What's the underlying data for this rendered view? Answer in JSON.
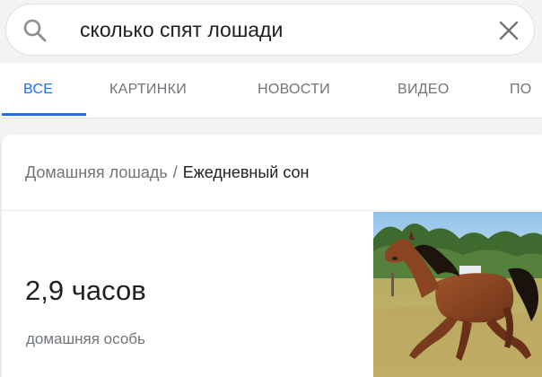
{
  "search": {
    "query": "сколько спят лошади",
    "search_icon": "search-icon",
    "clear_icon": "close-icon"
  },
  "tabs": [
    {
      "label": "ВСЕ",
      "active": true
    },
    {
      "label": "КАРТИНКИ",
      "active": false
    },
    {
      "label": "НОВОСТИ",
      "active": false
    },
    {
      "label": "ВИДЕО",
      "active": false
    },
    {
      "label": "ПО",
      "active": false
    }
  ],
  "answer_card": {
    "breadcrumb": {
      "parent": "Домашняя лошадь",
      "separator": "/",
      "current": "Ежедневный сон"
    },
    "value": "2,9 часов",
    "subtitle": "домашняя особь"
  },
  "colors": {
    "accent": "#1a73e8",
    "text_primary": "#202124",
    "text_secondary": "#70757a",
    "background": "#f1f3f4"
  }
}
